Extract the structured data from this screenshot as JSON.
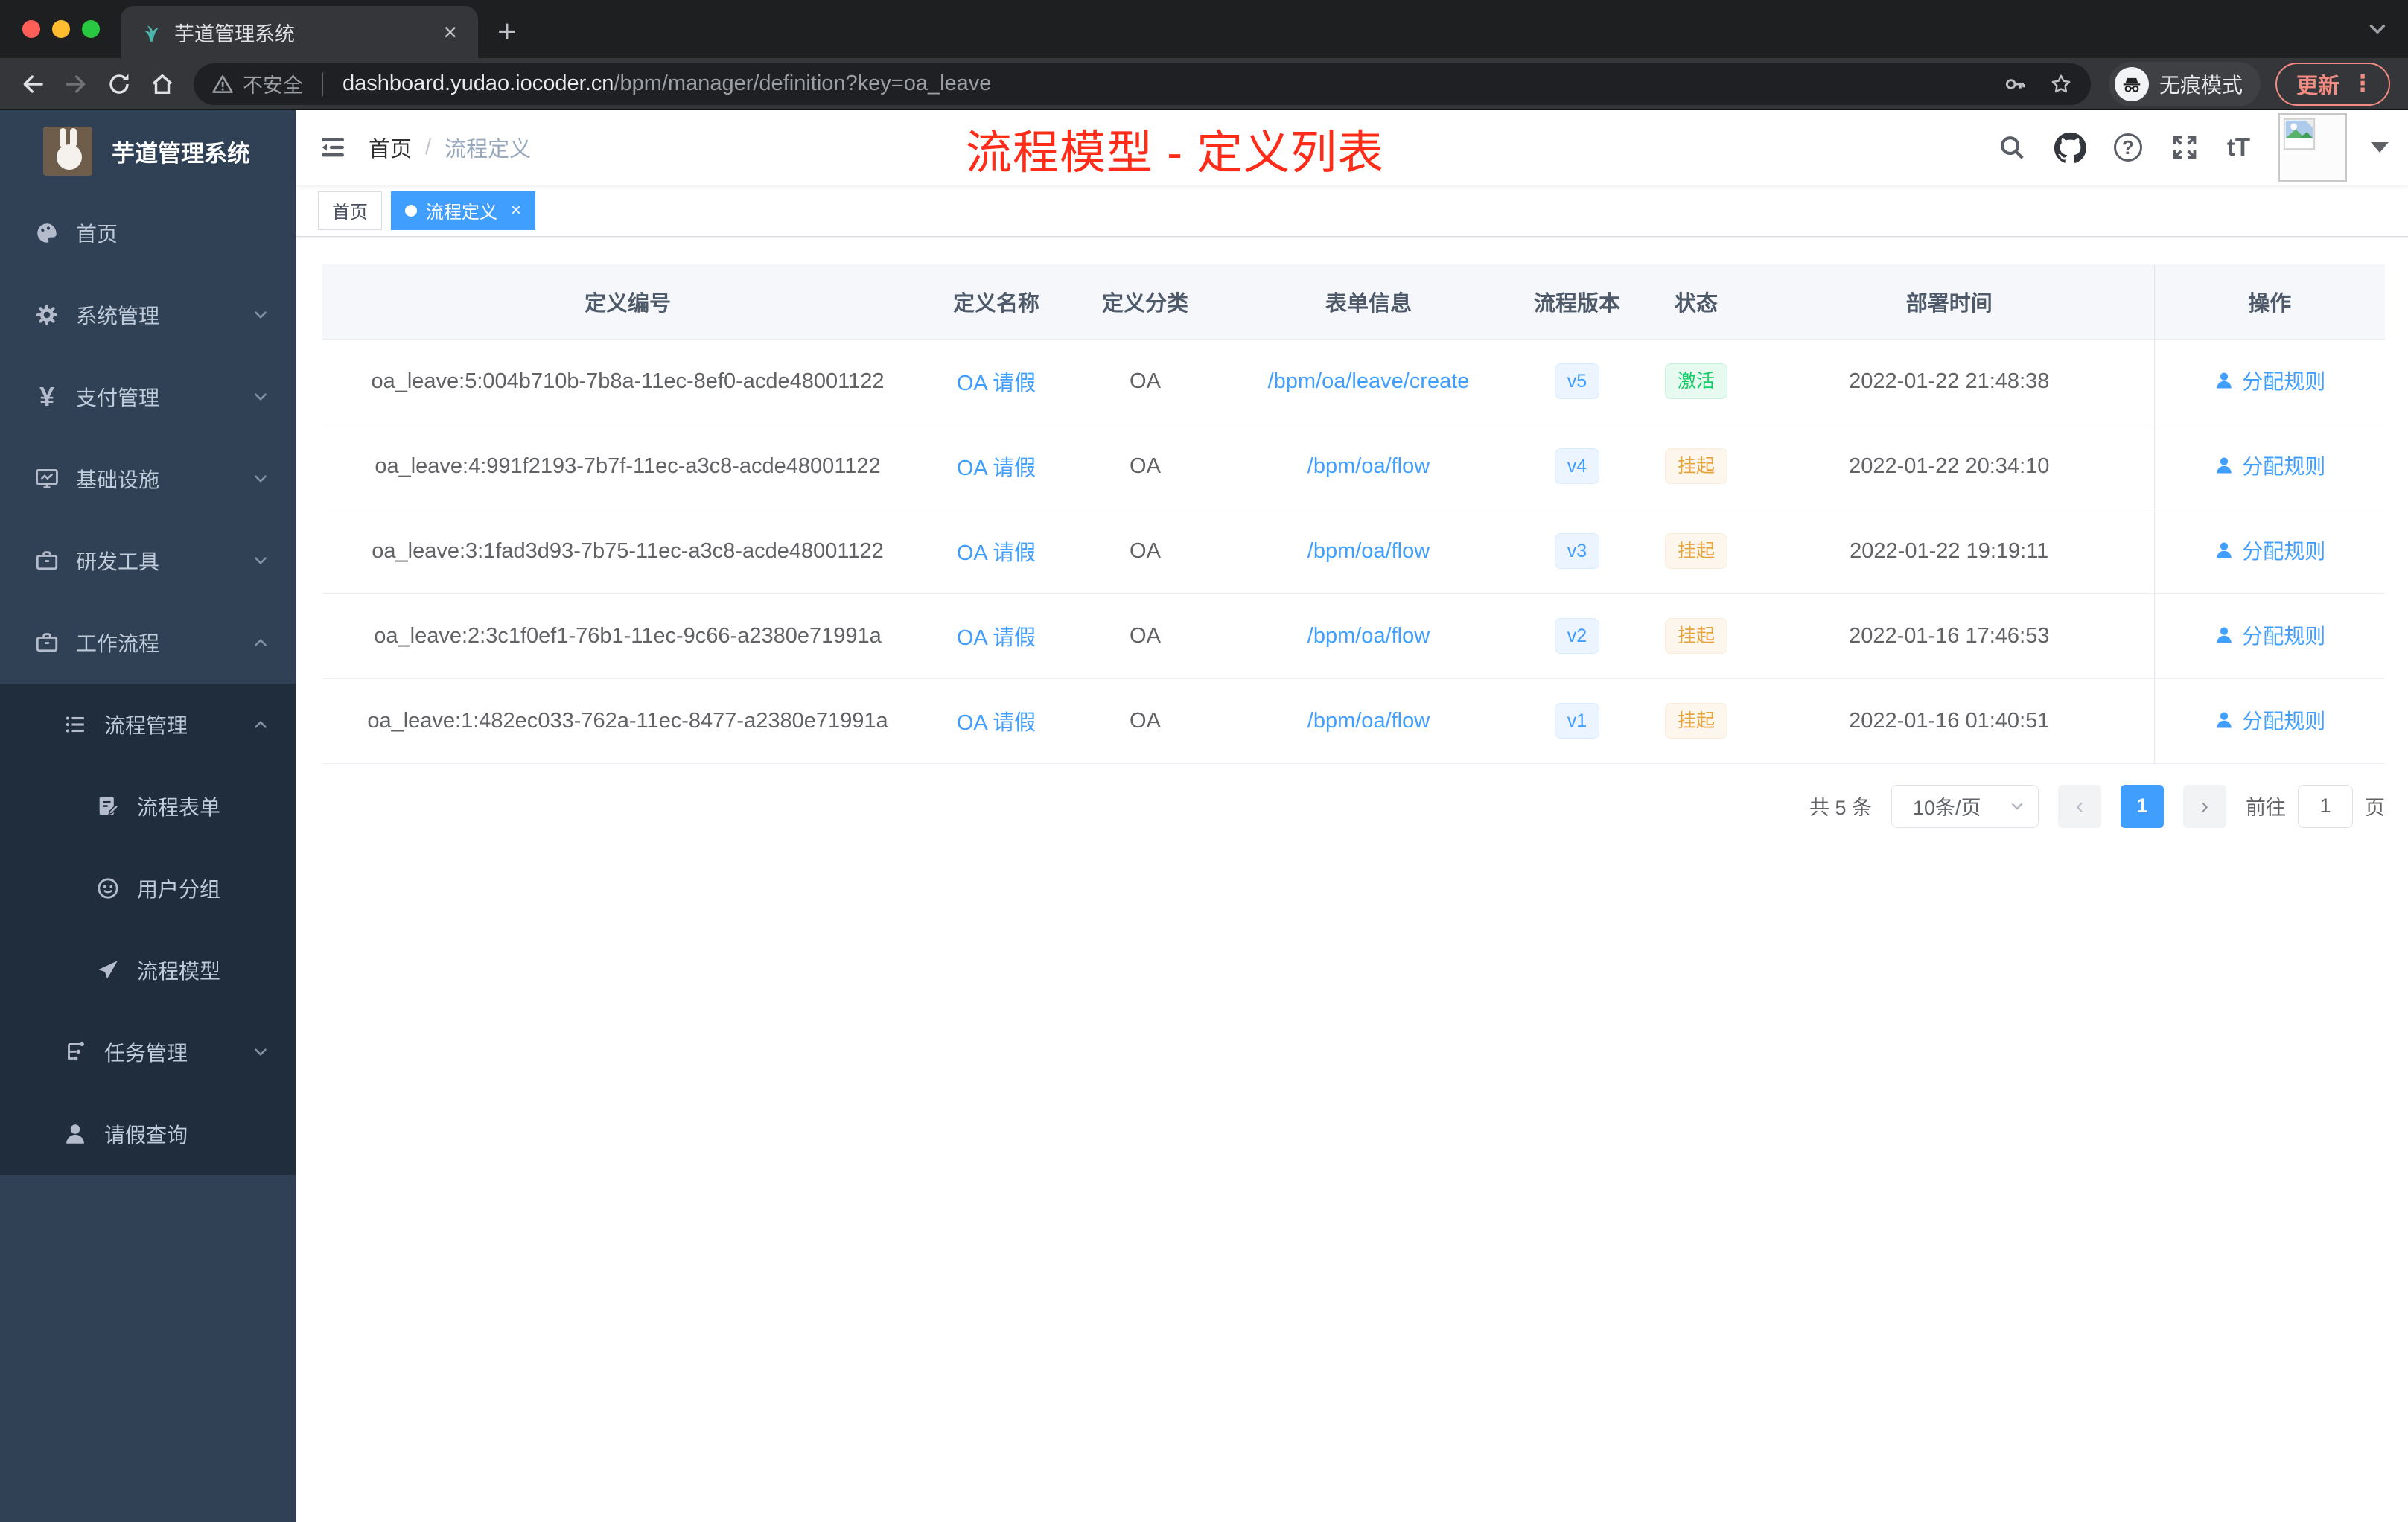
{
  "colors": {
    "accent": "#409eff",
    "success": "#13ce66",
    "warning": "#e6a23c",
    "annotation_red": "#fe2c19",
    "sidebar_bg": "#304156",
    "submenu_bg": "#1f2d3d"
  },
  "glyphs": {
    "close": "×",
    "plus": "+",
    "kebab": "⋮",
    "help": "?",
    "font_size": "tT",
    "yen": "¥",
    "slash": "/",
    "prev": "‹",
    "next": "›"
  },
  "browser": {
    "tab_title": "芋道管理系统",
    "security_label": "不安全",
    "url_host": "dashboard.yudao.iocoder.cn",
    "url_path": "/bpm/manager/definition?key=oa_leave",
    "incognito_label": "无痕模式",
    "update_label": "更新"
  },
  "sidebar": {
    "app_title": "芋道管理系统",
    "menu": [
      {
        "label": "首页"
      },
      {
        "label": "系统管理"
      },
      {
        "label": "支付管理"
      },
      {
        "label": "基础设施"
      },
      {
        "label": "研发工具"
      },
      {
        "label": "工作流程"
      }
    ],
    "workflow_submenu": {
      "process_management": {
        "label": "流程管理"
      },
      "children": [
        {
          "label": "流程表单"
        },
        {
          "label": "用户分组"
        },
        {
          "label": "流程模型"
        }
      ],
      "task_management": {
        "label": "任务管理"
      },
      "leave_query": {
        "label": "请假查询"
      }
    }
  },
  "header": {
    "breadcrumb": {
      "home": "首页",
      "current": "流程定义"
    },
    "annotation": "流程模型 - 定义列表"
  },
  "tags": {
    "home": "首页",
    "active": "流程定义"
  },
  "table": {
    "headers": [
      "定义编号",
      "定义名称",
      "定义分类",
      "表单信息",
      "流程版本",
      "状态",
      "部署时间",
      "操作"
    ],
    "action_label": "分配规则",
    "rows": [
      {
        "id": "oa_leave:5:004b710b-7b8a-11ec-8ef0-acde48001122",
        "name": "OA 请假",
        "category": "OA",
        "form": "/bpm/oa/leave/create",
        "version": "v5",
        "status": "激活",
        "deployed_at": "2022-01-22 21:48:38"
      },
      {
        "id": "oa_leave:4:991f2193-7b7f-11ec-a3c8-acde48001122",
        "name": "OA 请假",
        "category": "OA",
        "form": "/bpm/oa/flow",
        "version": "v4",
        "status": "挂起",
        "deployed_at": "2022-01-22 20:34:10"
      },
      {
        "id": "oa_leave:3:1fad3d93-7b75-11ec-a3c8-acde48001122",
        "name": "OA 请假",
        "category": "OA",
        "form": "/bpm/oa/flow",
        "version": "v3",
        "status": "挂起",
        "deployed_at": "2022-01-22 19:19:11"
      },
      {
        "id": "oa_leave:2:3c1f0ef1-76b1-11ec-9c66-a2380e71991a",
        "name": "OA 请假",
        "category": "OA",
        "form": "/bpm/oa/flow",
        "version": "v2",
        "status": "挂起",
        "deployed_at": "2022-01-16 17:46:53"
      },
      {
        "id": "oa_leave:1:482ec033-762a-11ec-8477-a2380e71991a",
        "name": "OA 请假",
        "category": "OA",
        "form": "/bpm/oa/flow",
        "version": "v1",
        "status": "挂起",
        "deployed_at": "2022-01-16 01:40:51"
      }
    ]
  },
  "pagination": {
    "total_label": "共 5 条",
    "page_size_label": "10条/页",
    "current_page": "1",
    "goto_label": "前往",
    "goto_value": "1",
    "page_unit": "页"
  }
}
